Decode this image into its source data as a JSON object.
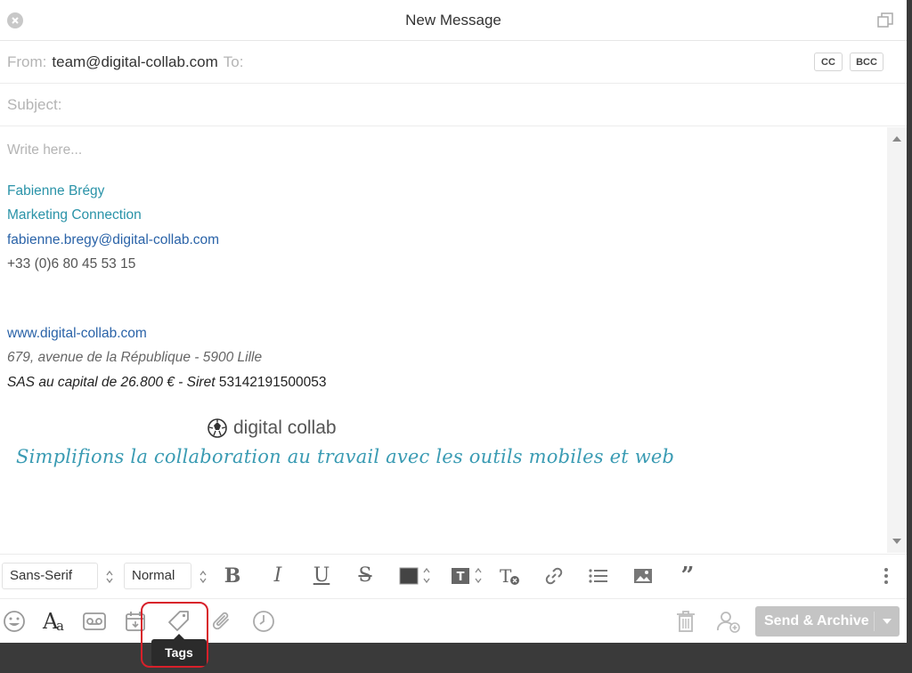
{
  "window": {
    "title": "New Message"
  },
  "header": {
    "from_label": "From:",
    "from_value": "team@digital-collab.com",
    "to_label": "To:",
    "cc_label": "CC",
    "bcc_label": "BCC",
    "subject_placeholder": "Subject:"
  },
  "body": {
    "placeholder": "Write here...",
    "signature": {
      "name": "Fabienne Brégy",
      "company": "Marketing Connection",
      "email": "fabienne.bregy@digital-collab.com",
      "phone": "+33 (0)6 80 45 53 15",
      "website": "www.digital-collab.com",
      "address": "679, avenue de la République - 5900 Lille",
      "legal_italic": "SAS au capital de 26.800 € - Siret",
      "legal_number": "53142191500053",
      "logo_text": "digital collab",
      "tagline": "Simplifions la collaboration au travail avec les outils mobiles et web"
    }
  },
  "format_toolbar": {
    "font": "Sans-Serif",
    "size": "Normal"
  },
  "action_bar": {
    "send_label": "Send & Archive",
    "tooltip": "Tags"
  },
  "colors": {
    "signature_teal": "#2a93a8",
    "link_blue": "#2a63a8",
    "highlight_red": "#d8202a",
    "send_disabled": "#c4c4c4"
  }
}
